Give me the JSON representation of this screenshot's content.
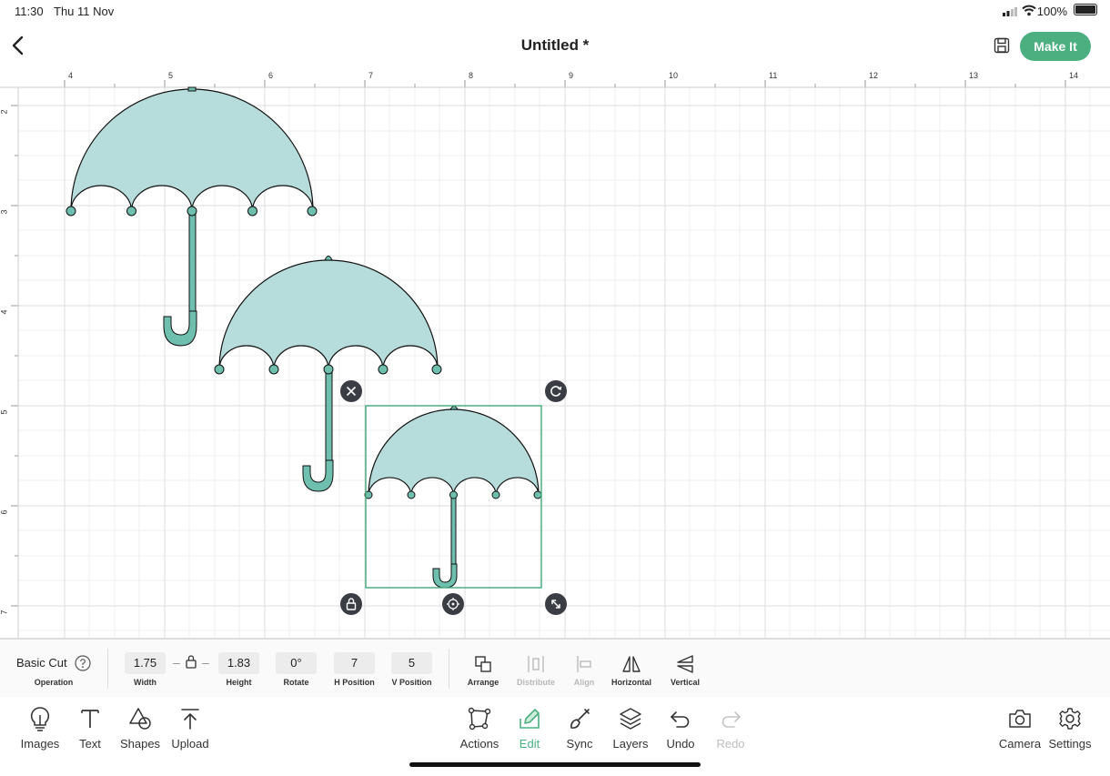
{
  "status_bar": {
    "time": "11:30",
    "date": "Thu 11 Nov",
    "battery": "100%"
  },
  "header": {
    "title": "Untitled *",
    "make_it": "Make It"
  },
  "canvas": {
    "ruler_x": [
      "4",
      "5",
      "6",
      "7",
      "8",
      "9",
      "10",
      "11",
      "12",
      "13",
      "14"
    ],
    "ruler_y": [
      "2",
      "3",
      "4",
      "5",
      "6",
      "7"
    ]
  },
  "toolbar": {
    "operation": {
      "value": "Basic Cut",
      "label": "Operation"
    },
    "width": {
      "value": "1.75",
      "label": "Width"
    },
    "height": {
      "value": "1.83",
      "label": "Height"
    },
    "rotate": {
      "value": "0°",
      "label": "Rotate"
    },
    "h_position": {
      "value": "7",
      "label": "H Position"
    },
    "v_position": {
      "value": "5",
      "label": "V Position"
    },
    "arrange": "Arrange",
    "distribute": "Distribute",
    "align": "Align",
    "flip_horizontal": "Horizontal",
    "flip_vertical": "Vertical"
  },
  "bottom_bar": {
    "images": "Images",
    "text": "Text",
    "shapes": "Shapes",
    "upload": "Upload",
    "actions": "Actions",
    "edit": "Edit",
    "sync": "Sync",
    "layers": "Layers",
    "undo": "Undo",
    "redo": "Redo",
    "camera": "Camera",
    "settings": "Settings"
  },
  "colors": {
    "accent": "#4caf80",
    "umbrella_fill": "#b6dcdb",
    "handle_fill": "#6fbfae"
  }
}
